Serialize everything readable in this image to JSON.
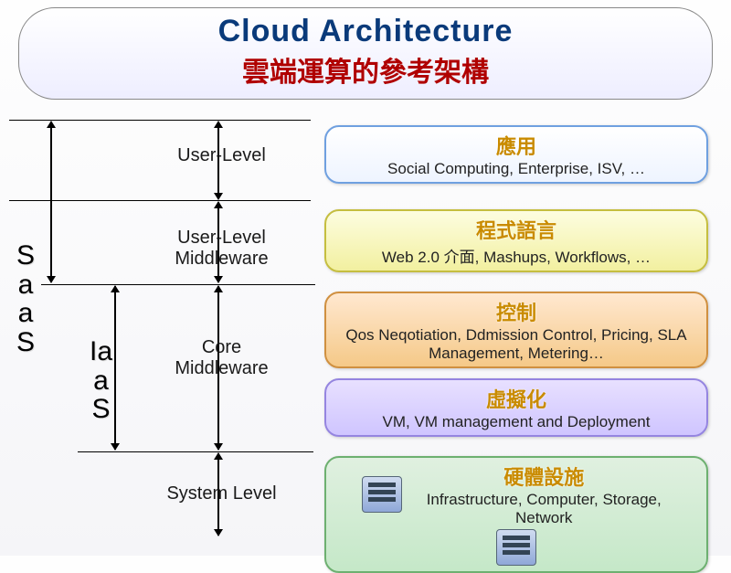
{
  "title": {
    "line1": "Cloud Architecture",
    "line2": "雲端運算的參考架構"
  },
  "side_labels": {
    "saas": "S\na\na\nS",
    "iaas": "Ia\na\nS"
  },
  "mid_labels": {
    "user_level": "User-Level",
    "user_level_middleware": "User-Level\nMiddleware",
    "core_middleware": "Core\nMiddleware",
    "system_level": "System Level"
  },
  "boxes": {
    "app": {
      "head": "應用",
      "sub": "Social Computing, Enterprise, ISV, …"
    },
    "lang": {
      "head": "程式語言",
      "sub": "Web 2.0 介面, Mashups, Workflows, …"
    },
    "control": {
      "head": "控制",
      "sub": "Qos Neqotiation, Ddmission Control, Pricing, SLA Management, Metering…"
    },
    "virt": {
      "head": "虛擬化",
      "sub": "VM, VM management and Deployment"
    },
    "hw": {
      "head": "硬體設施",
      "sub": "Infrastructure, Computer, Storage, Network"
    }
  }
}
